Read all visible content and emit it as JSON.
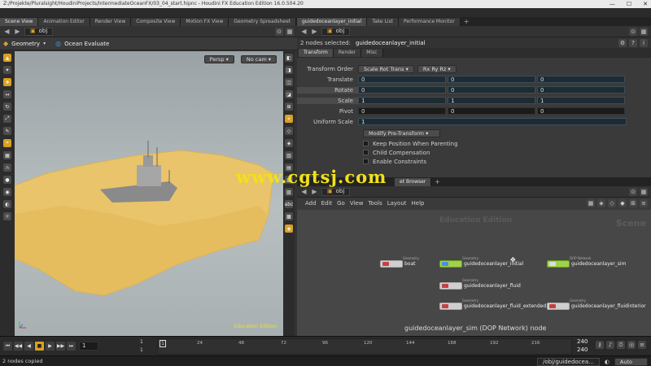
{
  "titlebar": {
    "text": "Z:/Projekte/Pluralsight/HoudiniProjects/IntermediateOceanFX/03_04_start.hipnc - Houdini FX Education Edition 16.0.504.20",
    "min": "—",
    "max": "☐",
    "close": "✕"
  },
  "left_tabs": [
    "Scene View",
    "Animation Editor",
    "Render View",
    "Composite View",
    "Motion FX View",
    "Geometry Spreadsheet"
  ],
  "right_tabs": [
    "guidedoceanlayer_initial",
    "Take List",
    "Performance Monitor"
  ],
  "left_path": "obj",
  "viewer": {
    "context": "Geometry",
    "operator": "Ocean Evaluate",
    "camera_persp": "Persp",
    "camera_nocam": "No cam",
    "watermark_corner": "Education Edition"
  },
  "param": {
    "path": "obj",
    "nodes_selected_label": "2 nodes selected:",
    "nodes_selected_value": "guidedoceanlayer_initial",
    "tabs": [
      "Transform",
      "Render",
      "Misc"
    ],
    "transform_order_label": "Transform Order",
    "transform_order_value": "Scale Rot Trans",
    "rot_order_value": "Rx Ry Rz",
    "translate_label": "Translate",
    "translate": [
      "0",
      "0",
      "0"
    ],
    "rotate_label": "Rotate",
    "rotate": [
      "0",
      "0",
      "0"
    ],
    "scale_label": "Scale",
    "scale": [
      "1",
      "1",
      "1"
    ],
    "pivot_label": "Pivot",
    "pivot": [
      "0",
      "0",
      "0"
    ],
    "uniform_scale_label": "Uniform Scale",
    "uniform_scale": "1",
    "modify_pretransform": "Modify Pre-Transform",
    "checkboxes": [
      "Keep Position When Parenting",
      "Child Compensation",
      "Enable Constraints"
    ]
  },
  "network": {
    "tab_label": "et Browser",
    "path": "obj",
    "menu": [
      "Add",
      "Edit",
      "Go",
      "View",
      "Tools",
      "Layout",
      "Help"
    ],
    "edition": "Education Edition",
    "scene": "Scene",
    "nodes": [
      {
        "name": "boat",
        "type": "Geometry"
      },
      {
        "name": "guidedoceanlayer_initial",
        "type": "Geometry"
      },
      {
        "name": "guidedoceanlayer_sim",
        "type": "DOP Network"
      },
      {
        "name": "guidedoceanlayer_fluid",
        "type": "Geometry"
      },
      {
        "name": "guidedoceanlayer_fluid_extended",
        "type": "Geometry"
      },
      {
        "name": "guidedoceanlayer_fluidinterior",
        "type": "Geometry"
      }
    ],
    "caption": "guidedoceanlayer_sim (DOP Network) node"
  },
  "timeline": {
    "frame": "1",
    "start": "1",
    "start2": "1",
    "ticks": [
      "1",
      "24",
      "48",
      "72",
      "96",
      "120",
      "144",
      "168",
      "192",
      "216"
    ],
    "end": "240",
    "end2": "240"
  },
  "status": {
    "message": "2 nodes copied",
    "path": "/obj/guidedocea...",
    "auto_update": "Auto Update"
  },
  "watermark": "www.cgtsj.com"
}
